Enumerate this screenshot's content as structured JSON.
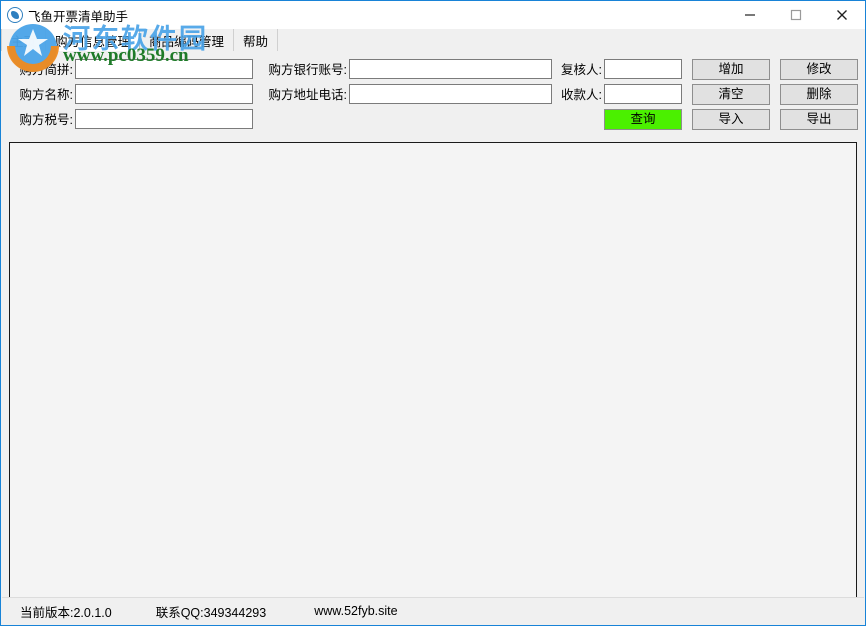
{
  "window": {
    "title": "飞鱼开票清单助手",
    "icon": "app-logo-icon",
    "minimize_label": "—",
    "maximize_label": "□",
    "close_label": "✕"
  },
  "tabs": [
    {
      "label": "主页",
      "active": false
    },
    {
      "label": "购方信息管理",
      "active": true
    },
    {
      "label": "商品编码管理",
      "active": false
    },
    {
      "label": "帮助",
      "active": false
    }
  ],
  "form": {
    "fields": [
      {
        "label": "购方简拼:",
        "value": "",
        "placeholder": "",
        "name": "buyer-short-pinyin"
      },
      {
        "label": "购方名称:",
        "value": "",
        "placeholder": "",
        "name": "buyer-name"
      },
      {
        "label": "购方税号:",
        "value": "",
        "placeholder": "",
        "name": "buyer-tax-id"
      },
      {
        "label": "购方银行账号:",
        "value": "",
        "placeholder": "",
        "name": "buyer-bank-account"
      },
      {
        "label": "购方地址电话:",
        "value": "",
        "placeholder": "",
        "name": "buyer-address-phone"
      },
      {
        "label": "复核人:",
        "value": "",
        "placeholder": "",
        "name": "reviewer"
      },
      {
        "label": "收款人:",
        "value": "",
        "placeholder": "",
        "name": "payee"
      }
    ]
  },
  "buttons": {
    "query": "查询",
    "add": "增加",
    "modify": "修改",
    "clear": "清空",
    "delete": "删除",
    "import": "导入",
    "export": "导出"
  },
  "colors": {
    "query_button_bg": "#4bf000",
    "window_border": "#1883d7",
    "button_bg": "#e1e1e1",
    "watermark_blue": "#4aa3e8",
    "watermark_green": "#1e7a28"
  },
  "statusbar": {
    "version": "当前版本:2.0.1.0",
    "qq": "联系QQ:349344293",
    "site": "www.52fyb.site"
  },
  "watermark": {
    "site_cn": "河东软件园",
    "site_url": "www.pc0359.cn"
  }
}
